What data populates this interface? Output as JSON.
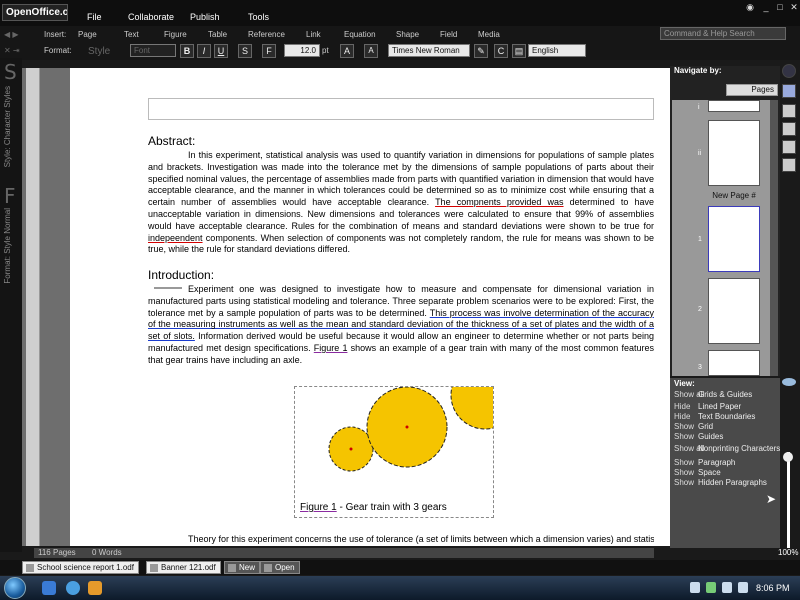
{
  "app": {
    "logo": "OpenOffice.org",
    "menu": [
      "File",
      "Collaborate",
      "Publish",
      "Tools"
    ],
    "command_search_placeholder": "Command & Help Search"
  },
  "toolbar_insert": {
    "label": "Insert:",
    "items": [
      "Page",
      "Text",
      "Figure",
      "Table",
      "Reference",
      "Link",
      "Equation",
      "Shape",
      "Field",
      "Media"
    ]
  },
  "toolbar_format": {
    "label": "Format:",
    "style_label": "Style",
    "font_label": "Font",
    "bold": "B",
    "italic": "I",
    "underline": "U",
    "strike": "S",
    "indent": "F",
    "font_size": "12.0",
    "unit": "pt",
    "grow": "A",
    "shrink": "A",
    "font_name": "Times New Roman",
    "language": "English"
  },
  "side": {
    "letter_s": "S",
    "char_styles": "Style: Character Styles",
    "letter_f": "F",
    "format_style": "Format: Style Normal"
  },
  "document": {
    "abstract_heading": "Abstract:",
    "abstract_pre": "In this experiment, statistical analysis was used to quantify variation in dimensions for populations of sample plates and brackets.  Investigation was made into the tolerance met by the dimensions of sample populations of parts about their specified nominal values, the percentage of assemblies made from parts with quantified variation in dimension that would have acceptable clearance, and the manner in which tolerances could be determined so as to minimize cost while ensuring that a certain number of assemblies would have acceptable clearance.  ",
    "abstract_ul1": "The compnents provided was",
    "abstract_mid": " determined to have unacceptable variation in dimensions.  New dimensions and tolerances were calculated to ensure that 99% of assemblies would have acceptable clearance.  Rules for the combination of means and standard deviations were shown to be true for ",
    "abstract_ul2": "indepeendent",
    "abstract_post": " components.  When selection of components was not completely random, the rule for means was shown to be true, while the rule for standard deviations differed.",
    "intro_heading": "Introduction:",
    "intro_pre": "Experiment one was designed to investigate how to measure and compensate for dimensional variation in manufactured parts using statistical modeling and tolerance.  Three separate problem scenarios were to be explored:  First, the tolerance met by a sample population of parts was to be determined.  ",
    "intro_ul1": "This process was involve determination of the accuracy of the measuring instruments as well as the mean and standard deviation of the thickness of a set of plates and the width of a set of slots.",
    "intro_mid": "  Information derived would be useful because it would allow an engineer to determine whether or not parts being manufactured met design specifications.  ",
    "intro_ul2": "Figure 1",
    "intro_post": " shows an example of a gear train with many of the most common features that gear trains have including an axle.",
    "figure_caption_link": "Figure 1",
    "figure_caption_rest": " - Gear train with 3 gears",
    "theory": "Theory for this experiment concerns the use of tolerance (a set of limits between which a dimension varies) and statistical"
  },
  "status": {
    "pages": "116 Pages",
    "words": "0 Words"
  },
  "tabs": [
    {
      "label": "School science report 1.odf"
    },
    {
      "label": "Banner 121.odf"
    },
    {
      "label": "New"
    },
    {
      "label": "Open"
    }
  ],
  "navigator": {
    "title": "Navigate by:",
    "pages_button": "Pages",
    "new_page": "New Page #",
    "page_numbers": [
      "i",
      "ii",
      "1",
      "2",
      "3"
    ]
  },
  "view": {
    "title": "View:",
    "rows": [
      {
        "action": "Show all",
        "label": "Grids & Guides"
      },
      {
        "action": "Hide",
        "label": "Lined Paper"
      },
      {
        "action": "Hide",
        "label": "Text Boundaries"
      },
      {
        "action": "Show",
        "label": "Grid"
      },
      {
        "action": "Show",
        "label": "Guides"
      },
      {
        "action": "Show all",
        "label": "Nonprinting Characters"
      },
      {
        "action": "Show",
        "label": "Paragraph"
      },
      {
        "action": "Show",
        "label": "Space"
      },
      {
        "action": "Show",
        "label": "Hidden Paragraphs"
      }
    ]
  },
  "zoom": "100%",
  "clock": "8:06 PM",
  "colors": {
    "gear_fill": "#f5c400",
    "underline_red": "#d40000",
    "underline_blue": "#1a3ccf",
    "underline_purple": "#8a2aa0"
  }
}
